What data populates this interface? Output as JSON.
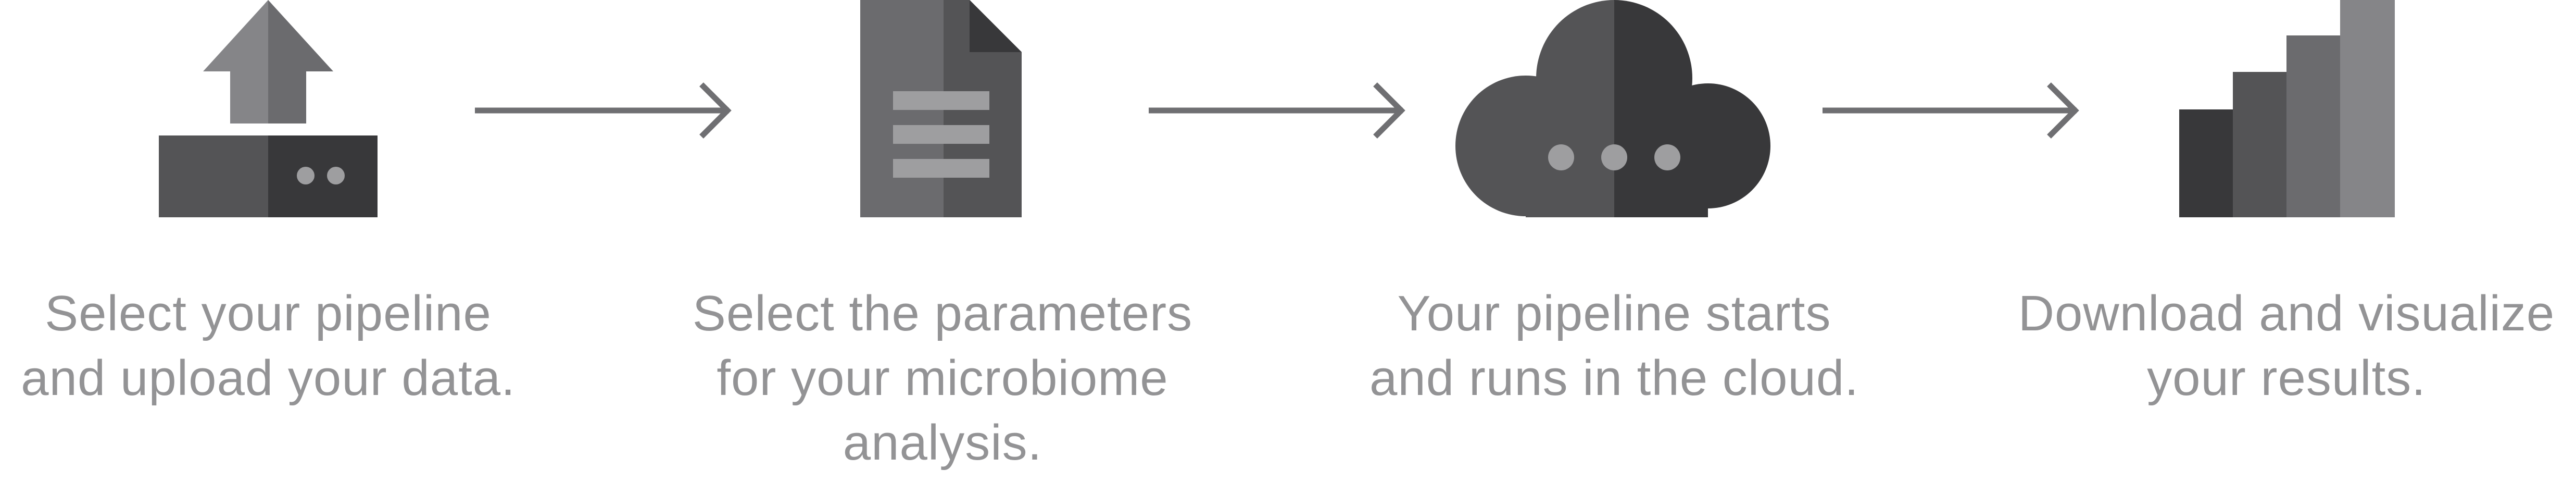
{
  "steps": [
    {
      "caption": "Select your pipeline\nand upload your data.",
      "icon": "upload-icon"
    },
    {
      "caption": "Select the parameters\nfor your microbiome\nanalysis.",
      "icon": "document-icon"
    },
    {
      "caption": "Your pipeline starts\nand runs in the cloud.",
      "icon": "cloud-icon"
    },
    {
      "caption": "Download and visualize\nyour results.",
      "icon": "bar-chart-icon"
    }
  ],
  "colors": {
    "darkest": "#38383a",
    "dark": "#545456",
    "mid": "#6b6b6e",
    "light": "#858588",
    "lighter": "#9e9ea0",
    "text": "#939395",
    "arrow": "#6f6f72"
  }
}
